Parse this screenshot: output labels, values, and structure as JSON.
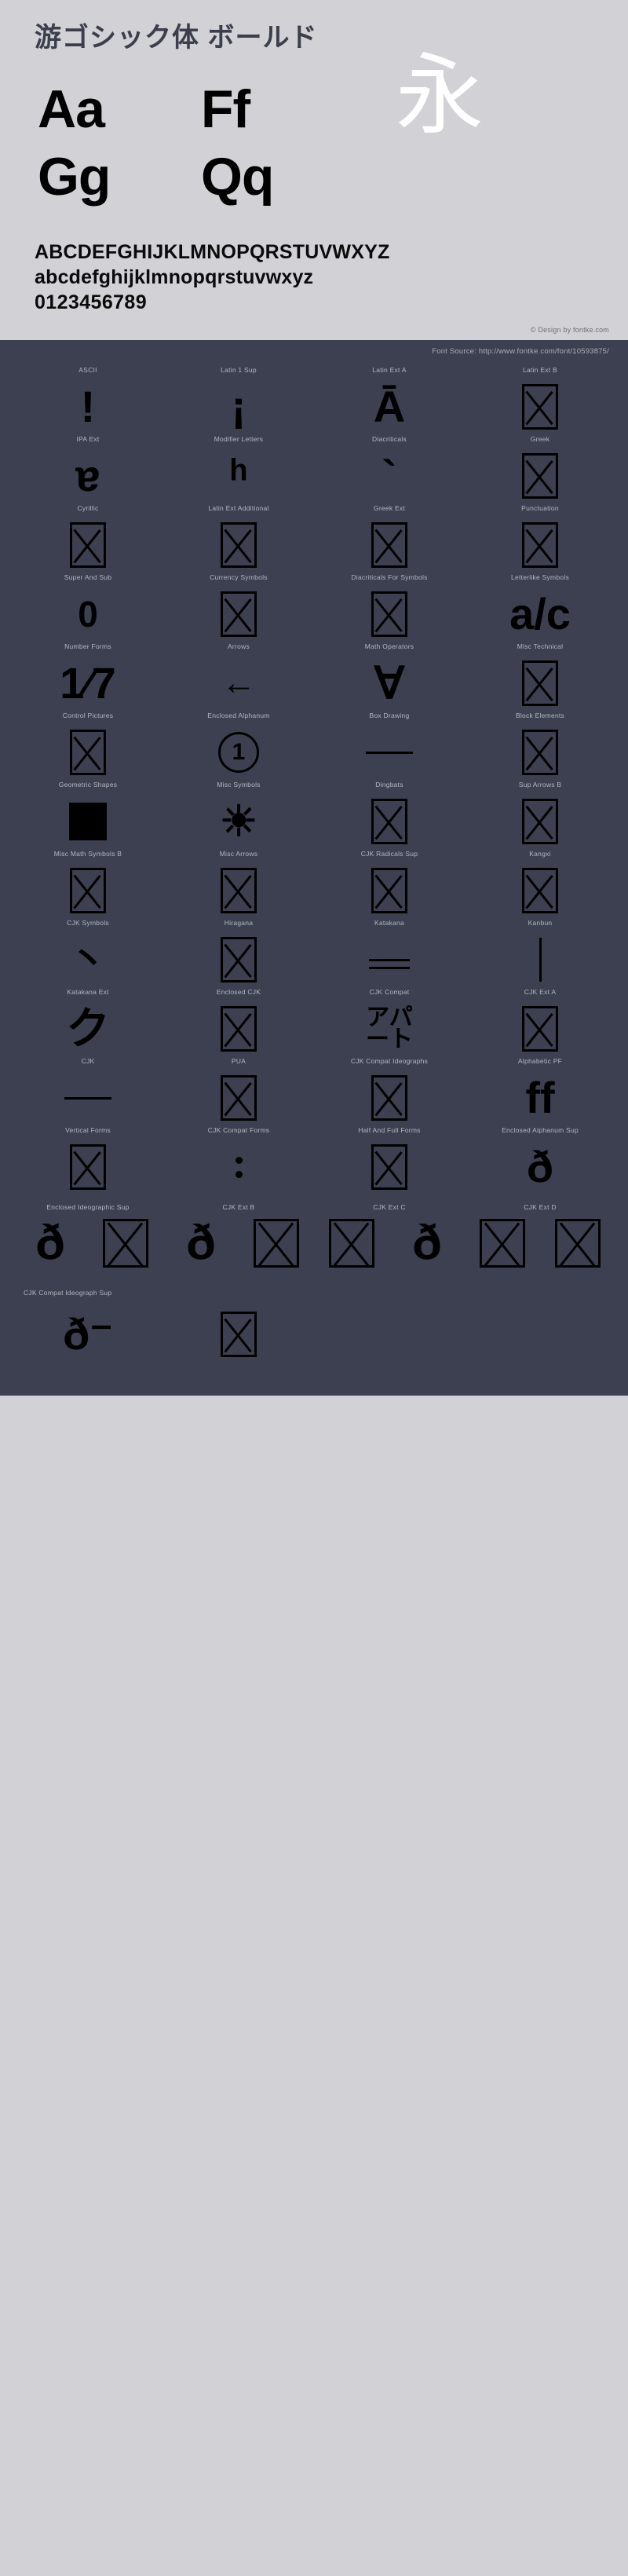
{
  "hero": {
    "title": "游ゴシック体 ボールド",
    "specimen_rows": [
      [
        {
          "text": "Aa",
          "kind": "latin"
        },
        {
          "text": "Ff",
          "kind": "latin"
        },
        {
          "text": "永",
          "kind": "cjk"
        }
      ],
      [
        {
          "text": "Gg",
          "kind": "latin"
        },
        {
          "text": "Qq",
          "kind": "latin"
        }
      ]
    ],
    "alphabet_upper": "ABCDEFGHIJKLMNOPQRSTUVWXYZ",
    "alphabet_lower": "abcdefghijklmnopqrstuvwxyz",
    "digits": "0123456789",
    "credit": "© Design by fontke.com"
  },
  "dark": {
    "source_line": "Font Source: http://www.fontke.com/font/10593875/",
    "blocks": [
      {
        "label": "ASCII",
        "glyph": "!",
        "type": "char",
        "size": "big"
      },
      {
        "label": "Latin 1 Sup",
        "glyph": "¡",
        "type": "char",
        "size": "big"
      },
      {
        "label": "Latin Ext A",
        "glyph": "Ā",
        "type": "char",
        "size": "big"
      },
      {
        "label": "Latin Ext B",
        "glyph": "",
        "type": "tofu",
        "size": ""
      },
      {
        "label": "IPA Ext",
        "glyph": "ɐ",
        "type": "char",
        "size": "big"
      },
      {
        "label": "Modifier Letters",
        "glyph": "ʰ",
        "type": "char",
        "size": "big"
      },
      {
        "label": "Diacriticals",
        "glyph": "`",
        "type": "char",
        "size": "big"
      },
      {
        "label": "Greek",
        "glyph": "",
        "type": "tofu",
        "size": ""
      },
      {
        "label": "Cyrillic",
        "glyph": "",
        "type": "tofu",
        "size": ""
      },
      {
        "label": "Latin Ext Additional",
        "glyph": "",
        "type": "tofu",
        "size": ""
      },
      {
        "label": "Greek Ext",
        "glyph": "",
        "type": "tofu",
        "size": ""
      },
      {
        "label": "Punctuation",
        "glyph": "",
        "type": "tofu",
        "size": ""
      },
      {
        "label": "Super And Sub",
        "glyph": "0",
        "type": "char",
        "size": ""
      },
      {
        "label": "Currency Symbols",
        "glyph": "",
        "type": "tofu",
        "size": ""
      },
      {
        "label": "Diacriticals For Symbols",
        "glyph": "",
        "type": "tofu",
        "size": ""
      },
      {
        "label": "Letterlike Symbols",
        "glyph": "a/c",
        "type": "char",
        "size": "big"
      },
      {
        "label": "Number Forms",
        "glyph": "1⁄7",
        "type": "char",
        "size": "big"
      },
      {
        "label": "Arrows",
        "glyph": "←",
        "type": "arrow",
        "size": ""
      },
      {
        "label": "Math Operators",
        "glyph": "∀",
        "type": "char",
        "size": "big"
      },
      {
        "label": "Misc Technical",
        "glyph": "",
        "type": "tofu",
        "size": ""
      },
      {
        "label": "Control Pictures",
        "glyph": "",
        "type": "tofu",
        "size": ""
      },
      {
        "label": "Enclosed Alphanum",
        "glyph": "1",
        "type": "circled",
        "size": ""
      },
      {
        "label": "Box Drawing",
        "glyph": "─",
        "type": "hline",
        "size": ""
      },
      {
        "label": "Block Elements",
        "glyph": "",
        "type": "tofu",
        "size": ""
      },
      {
        "label": "Geometric Shapes",
        "glyph": "■",
        "type": "square",
        "size": ""
      },
      {
        "label": "Misc Symbols",
        "glyph": "☀",
        "type": "sun",
        "size": ""
      },
      {
        "label": "Dingbats",
        "glyph": "",
        "type": "tofu",
        "size": ""
      },
      {
        "label": "Sup Arrows B",
        "glyph": "",
        "type": "tofu",
        "size": ""
      },
      {
        "label": "Misc Math Symbols B",
        "glyph": "",
        "type": "tofu",
        "size": ""
      },
      {
        "label": "Misc Arrows",
        "glyph": "",
        "type": "tofu",
        "size": ""
      },
      {
        "label": "CJK Radicals Sup",
        "glyph": "",
        "type": "tofu",
        "size": ""
      },
      {
        "label": "Kangxi",
        "glyph": "",
        "type": "tofu",
        "size": ""
      },
      {
        "label": "CJK Symbols",
        "glyph": "丶",
        "type": "char",
        "size": ""
      },
      {
        "label": "Hiragana",
        "glyph": "",
        "type": "tofu",
        "size": ""
      },
      {
        "label": "Katakana",
        "glyph": "〓",
        "type": "dbl",
        "size": ""
      },
      {
        "label": "Kanbun",
        "glyph": "|",
        "type": "vline",
        "size": ""
      },
      {
        "label": "Katakana Ext",
        "glyph": "ク",
        "type": "char",
        "size": "big"
      },
      {
        "label": "Enclosed CJK",
        "glyph": "",
        "type": "tofu",
        "size": ""
      },
      {
        "label": "CJK Compat",
        "glyph": "アパート",
        "type": "char",
        "size": "stack"
      },
      {
        "label": "CJK Ext A",
        "glyph": "",
        "type": "tofu",
        "size": ""
      },
      {
        "label": "CJK",
        "glyph": "▬",
        "type": "hline",
        "size": ""
      },
      {
        "label": "PUA",
        "glyph": "",
        "type": "tofu",
        "size": ""
      },
      {
        "label": "CJK Compat Ideographs",
        "glyph": "",
        "type": "tofu",
        "size": ""
      },
      {
        "label": "Alphabetic PF",
        "glyph": "ff",
        "type": "char",
        "size": "big"
      },
      {
        "label": "Vertical Forms",
        "glyph": "",
        "type": "tofu",
        "size": ""
      },
      {
        "label": "CJK Compat Forms",
        "glyph": "︰",
        "type": "dots",
        "size": ""
      },
      {
        "label": "Half And Full Forms",
        "glyph": "",
        "type": "tofu",
        "size": ""
      },
      {
        "label": "Enclosed Alphanum Sup",
        "glyph": "ð",
        "type": "char",
        "size": "big"
      }
    ],
    "dense_rows": [
      {
        "labels": [
          "Enclosed Ideographic Sup",
          "CJK Ext B",
          "CJK Ext C",
          "CJK Ext D"
        ],
        "cells": [
          {
            "glyph": "ð",
            "type": "char"
          },
          {
            "glyph": "",
            "type": "tofu"
          },
          {
            "glyph": "ð",
            "type": "char"
          },
          {
            "glyph": "",
            "type": "tofu"
          },
          {
            "glyph": "",
            "type": "tofu"
          },
          {
            "glyph": "ð",
            "type": "char"
          },
          {
            "glyph": "",
            "type": "tofu"
          },
          {
            "glyph": "",
            "type": "tofu"
          }
        ]
      }
    ],
    "final_row": {
      "label": "CJK Compat Ideograph Sup",
      "cells": [
        {
          "glyph": "ð⁻",
          "type": "char"
        },
        {
          "glyph": "",
          "type": "tofu"
        }
      ]
    }
  },
  "colors": {
    "page_light": "#d2d1d6",
    "page_dark": "#3c4051",
    "title_text": "#3b3f4c",
    "glyph_black": "#000000",
    "cjk_white": "#ffffff",
    "label_gray": "#b4b7c2"
  }
}
